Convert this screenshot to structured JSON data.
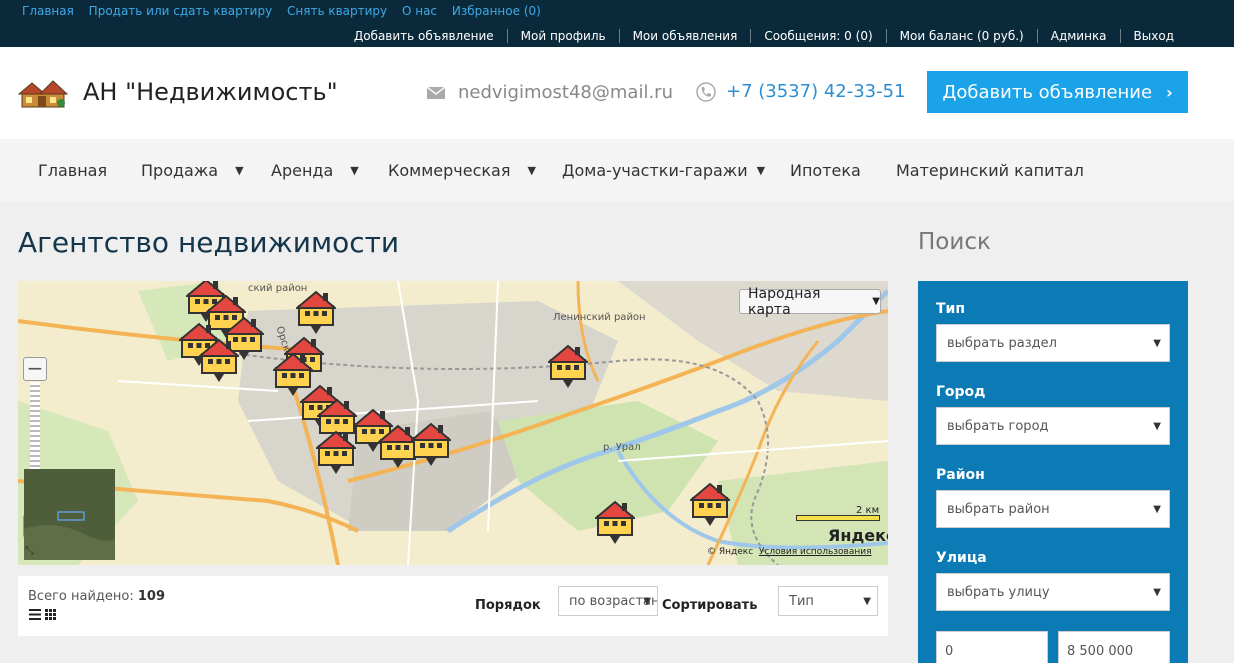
{
  "topbar": {
    "links": [
      "Главная",
      "Продать или сдать квартиру",
      "Снять квартиру",
      "О нас",
      "Избранное (0)"
    ],
    "user_links": [
      "Добавить объявление",
      "Мой профиль",
      "Мои объявления",
      "Сообщения: 0 (0)",
      "Мои баланс (0 руб.)",
      "Админка",
      "Выход"
    ]
  },
  "header": {
    "site_title": "АН \"Недвижимость\"",
    "email": "nedvigimost48@mail.ru",
    "phone": "+7 (3537) 42-33-51",
    "add_button": "Добавить объявление"
  },
  "nav": {
    "items": [
      "Главная",
      "Продажа",
      "Аренда",
      "Коммерческая",
      "Дома-участки-гаражи",
      "Ипотека",
      "Материнский капитал"
    ]
  },
  "page": {
    "title": "Агентство недвижимости",
    "search_title": "Поиск"
  },
  "map": {
    "layer_select": "Народная карта",
    "district_label": "Ленинский район",
    "district_label_2": "ский район",
    "street_label": "р. Урал",
    "street_label_2": "Орская ул",
    "scale": "2 км",
    "brand": "Яндекс",
    "copyright": "© Яндекс",
    "terms": "Условия использования",
    "zoom_in": "+",
    "zoom_out": "−",
    "pin_count": 17
  },
  "results": {
    "found_label": "Всего найдено:",
    "found_count": "109",
    "order_label": "Порядок",
    "order_value": "по возрастанию",
    "sort_label": "Сортировать",
    "sort_value": "Тип"
  },
  "search": {
    "type_label": "Тип",
    "type_value": "выбрать раздел",
    "city_label": "Город",
    "city_value": "выбрать город",
    "district_label": "Район",
    "district_value": "выбрать район",
    "street_label": "Улица",
    "street_value": "выбрать улицу",
    "price_from": "0",
    "price_to": "8 500 000"
  },
  "colors": {
    "topbar": "#0a2a3b",
    "accent": "#1aa3e8",
    "panel": "#0c7bb5",
    "link": "#3fa9e6"
  }
}
